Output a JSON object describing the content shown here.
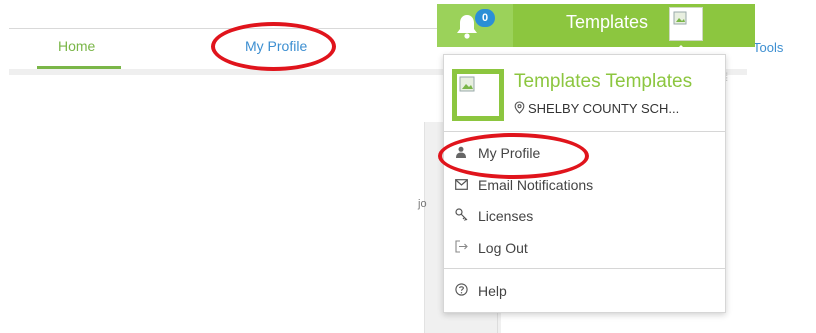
{
  "nav": {
    "home_label": "Home",
    "profile_label": "My Profile",
    "tools_label": "Tools"
  },
  "behind": {
    "partial_text": "jo"
  },
  "topbar": {
    "notification_count": "0",
    "title": "Templates"
  },
  "dropdown": {
    "user_name": "Templates Templates",
    "school": "SHELBY COUNTY SCH...",
    "items": [
      {
        "label": "My Profile",
        "icon": "user-icon"
      },
      {
        "label": "Email Notifications",
        "icon": "envelope-icon"
      },
      {
        "label": "Licenses",
        "icon": "key-icon"
      },
      {
        "label": "Log Out",
        "icon": "logout-icon"
      }
    ],
    "help": {
      "label": "Help",
      "icon": "question-circle-icon"
    }
  },
  "colors": {
    "brand_green": "#8cc63f",
    "link_blue": "#3d8fd1",
    "badge_blue": "#2b8fd6",
    "annotation_red": "#e0141c"
  }
}
